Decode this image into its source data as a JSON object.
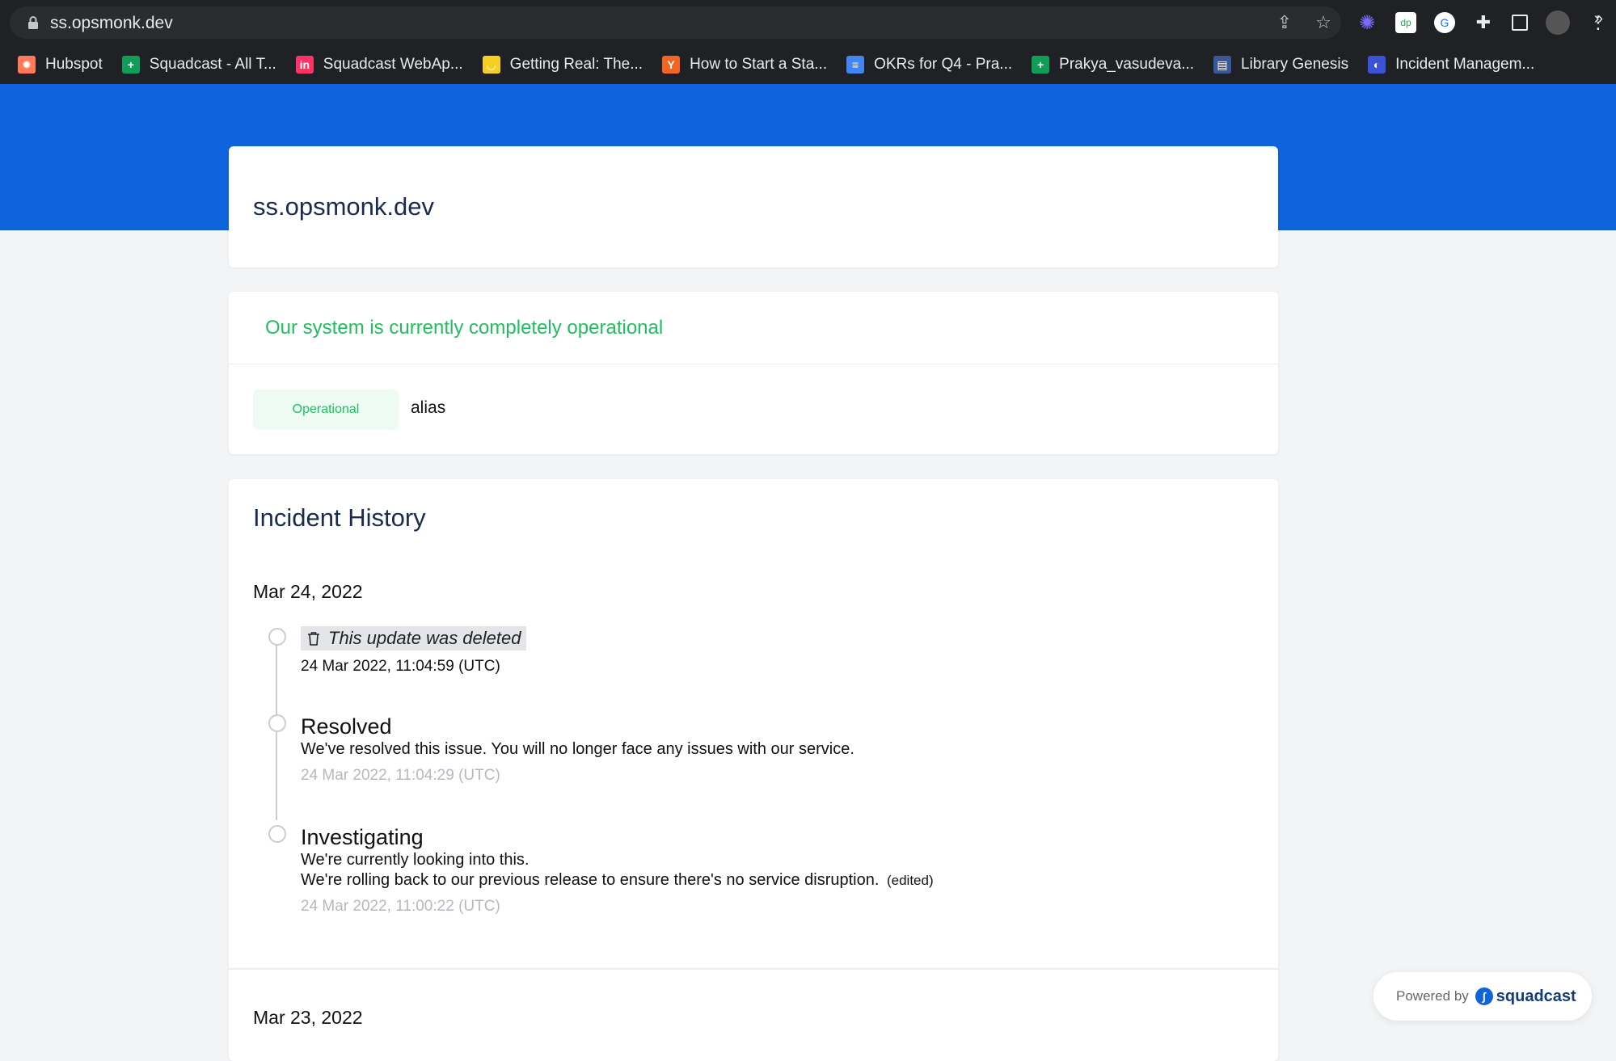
{
  "browser": {
    "url": "ss.opsmonk.dev",
    "bookmarks": [
      {
        "label": "Hubspot",
        "icon": "hubspot-icon",
        "color": "#ff7a59",
        "glyph": "✹"
      },
      {
        "label": "Squadcast - All T...",
        "icon": "sheets-icon",
        "color": "#0f9d58",
        "glyph": "+"
      },
      {
        "label": "Squadcast WebAp...",
        "icon": "invision-icon",
        "color": "#ff3366",
        "glyph": "in"
      },
      {
        "label": "Getting Real: The...",
        "icon": "basecamp-icon",
        "color": "#f5d022",
        "glyph": "◡"
      },
      {
        "label": "How to Start a Sta...",
        "icon": "ycombinator-icon",
        "color": "#f26522",
        "glyph": "Y"
      },
      {
        "label": "OKRs for Q4 - Pra...",
        "icon": "docs-icon",
        "color": "#4285f4",
        "glyph": "≡"
      },
      {
        "label": "Prakya_vasudeva...",
        "icon": "sheets-icon",
        "color": "#0f9d58",
        "glyph": "+"
      },
      {
        "label": "Library Genesis",
        "icon": "library-icon",
        "color": "#3b5998",
        "glyph": "▤"
      },
      {
        "label": "Incident Managem...",
        "icon": "globe-icon",
        "color": "#3b52d6",
        "glyph": "◐"
      }
    ],
    "more": "»"
  },
  "header": {
    "site_title": "ss.opsmonk.dev"
  },
  "status": {
    "message": "Our system is currently completely operational",
    "components": [
      {
        "badge": "Operational",
        "name": "alias"
      }
    ],
    "color": "#1fbf5f"
  },
  "history": {
    "title": "Incident History",
    "days": [
      {
        "date": "Mar 24, 2022",
        "updates": [
          {
            "deleted_label": "This update was deleted",
            "timestamp": "24 Mar 2022, 11:04:59 (UTC)"
          },
          {
            "status": "Resolved",
            "message": "We've resolved this issue. You will no longer face any issues with our service.",
            "timestamp": "24 Mar 2022, 11:04:29 (UTC)"
          },
          {
            "status": "Investigating",
            "message_line1": "We're currently looking into this.",
            "message_line2": "We're rolling back to our previous release to ensure there's no service disruption.",
            "edited": "(edited)",
            "timestamp": "24 Mar 2022, 11:00:22 (UTC)"
          }
        ]
      },
      {
        "date": "Mar 23, 2022"
      }
    ]
  },
  "footer": {
    "powered_by": "Powered by",
    "brand": "squadcast"
  },
  "colors": {
    "brand_blue": "#0f63dd",
    "title_navy": "#1b2a4e"
  }
}
